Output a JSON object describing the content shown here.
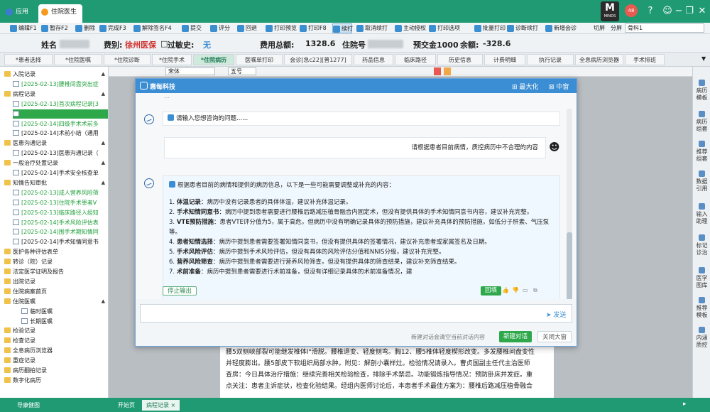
{
  "titlebar": {
    "tabs": [
      {
        "label": "应用"
      },
      {
        "label": "住院医生站"
      }
    ],
    "logo_text": "MINDS",
    "notification_badge": "48",
    "close_icon": "×"
  },
  "toolbar": {
    "buttons": [
      "编辑F1",
      "暂存F2",
      "删除",
      "完成F3",
      "解除签名F4",
      "提交",
      "评分",
      "回退",
      "打印预览",
      "打印F8",
      "续打",
      "取消续打",
      "主动授权",
      "打印选项",
      "批量打印",
      "诊断续打",
      "新增会诊"
    ],
    "active": "续打",
    "split_labels": [
      "切屏",
      "分屏"
    ],
    "font_value": "骨科1"
  },
  "patient": {
    "name_label": "姓名",
    "fee_label": "费别:",
    "fee_value": "徐州医保",
    "allergy_label": "过敏史:",
    "allergy_value": "无",
    "total_label": "费用总额:",
    "total_value": "1328.6",
    "admission_label": "住院号",
    "prepay_label": "预交金1000",
    "balance_label": "余额:",
    "balance_value": "-328.6"
  },
  "tabs": [
    "*患者选择",
    "*住院医嘱",
    "*住院诊断",
    "*住院手术",
    "*住院病历",
    "医嘱单打印",
    "会诊[急c22][普1277]",
    "药品信息",
    "临床路径",
    "历史信息",
    "计费明细",
    "执行记录",
    "全息病历浏览器",
    "手术排班"
  ],
  "active_tab": "*住院病历",
  "tree": [
    {
      "label": "入院记录",
      "type": "folder",
      "level": 0,
      "exp": "▲"
    },
    {
      "label": "[2025-02-13]腰椎间盘突出症",
      "type": "doc",
      "level": 1,
      "green": true
    },
    {
      "label": "病程记录",
      "type": "folder",
      "level": 0,
      "exp": "▲"
    },
    {
      "label": "[2025-02-13]首次病程记录[3",
      "type": "doc",
      "level": 1,
      "green": true
    },
    {
      "label": "",
      "type": "doc",
      "level": 1,
      "sel": true
    },
    {
      "label": "[2025-02-14]四级手术术前多",
      "type": "doc",
      "level": 1,
      "green": true
    },
    {
      "label": "[2025-02-14]术前小结（通用",
      "type": "doc",
      "level": 1
    },
    {
      "label": "医患沟通记录",
      "type": "folder",
      "level": 0,
      "exp": "▲"
    },
    {
      "label": "[2025-02-13]医患沟通记录（",
      "type": "doc",
      "level": 1
    },
    {
      "label": "一般治疗处置记录",
      "type": "folder",
      "level": 0,
      "exp": "▲"
    },
    {
      "label": "[2025-02-14]手术安全核查单",
      "type": "doc",
      "level": 1
    },
    {
      "label": "知情告知审批",
      "type": "folder",
      "level": 0,
      "exp": "▲"
    },
    {
      "label": "[2025-02-13]成人营养风险筛",
      "type": "doc",
      "level": 1,
      "green": true
    },
    {
      "label": "[2025-02-13]住院手术患者V",
      "type": "doc",
      "level": 1,
      "green": true
    },
    {
      "label": "[2025-02-13]临床路径入组知",
      "type": "doc",
      "level": 1,
      "green": true
    },
    {
      "label": "[2025-02-14]手术风险评估表",
      "type": "doc",
      "level": 1,
      "green": true
    },
    {
      "label": "[2025-02-14]围手术期知情同",
      "type": "doc",
      "level": 1,
      "green": true
    },
    {
      "label": "[2025-02-14]手术知情同意书",
      "type": "doc",
      "level": 1
    },
    {
      "label": "医护各种评估表单",
      "type": "folder",
      "level": 0
    },
    {
      "label": "转诊（院）记录",
      "type": "folder",
      "level": 0
    },
    {
      "label": "法定医学证明及报告",
      "type": "folder",
      "level": 0
    },
    {
      "label": "出院记录",
      "type": "folder",
      "level": 0
    },
    {
      "label": "住院病案首页",
      "type": "folder",
      "level": 0
    },
    {
      "label": "住院医嘱",
      "type": "folder",
      "level": 0,
      "exp": "▲"
    },
    {
      "label": "临时医嘱",
      "type": "doc",
      "level": 2
    },
    {
      "label": "长期医嘱",
      "type": "doc",
      "level": 2
    },
    {
      "label": "检验记录",
      "type": "folder",
      "level": 0
    },
    {
      "label": "检查记录",
      "type": "folder",
      "level": 0
    },
    {
      "label": "全息病历浏览器",
      "type": "folder",
      "level": 0
    },
    {
      "label": "重症记录",
      "type": "folder",
      "level": 0
    },
    {
      "label": "病历翻拍记录",
      "type": "folder",
      "level": 0
    },
    {
      "label": "数字化病历",
      "type": "folder",
      "level": 0
    }
  ],
  "editor": {
    "font": "宋体",
    "size": "五号",
    "page_lines": [
      "腰5双侧峡部裂可能继发椎体I°滑脱。腰椎退变、轻度侧弯。胸12、腰5椎体轻度楔形改变。多发腰椎间盘变性",
      "并轻度膨出。腰5部皮下软组织局部水肿。附见：解剖小囊样灶。检验情况请录入。曹贞国副主任代主治医师",
      "查房：今日具体治疗措施：继续完善相关检验检查，排除手术禁忌。功能锻炼指导情况：预防卧床并发症。重",
      "点关注：患者主诉症状，检查化验结果。经组内医师讨论后，本患者手术最佳方案为：腰椎后路减压植骨融合"
    ]
  },
  "right_tools": [
    "病历模板",
    "病历组套",
    "推荐组套",
    "数据引用",
    "输入助理",
    "标记诊治",
    "医学图库",
    "推荐模板",
    "内涵质控"
  ],
  "bottom_tabs": [
    {
      "label": "导康健图"
    },
    {
      "label": "开始页"
    },
    {
      "label": "病程记录"
    }
  ],
  "dialog": {
    "brand": "惠每科技",
    "maximize_label": "最大化",
    "center_label": "中窗",
    "top_fragment": "…",
    "prompt_hint": "请输入您想咨询的问题......",
    "user_message": "请根据患者目前病情，质控病历中不合理的内容",
    "answer_intro": "根据患者目前的病情和提供的病历信息，以下是一些可能需要调整或补充的内容：",
    "answer_items": [
      {
        "num": "1.",
        "title": "体温记录",
        "text": "：病历中没有记录患者的具体体温，建议补充体温记录。"
      },
      {
        "num": "2.",
        "title": "手术知情同意书",
        "text": "：病历中提到患者需要进行腰椎后路减压植骨融合内固定术，但没有提供具体的手术知情同意书内容，建议补充完整。"
      },
      {
        "num": "3.",
        "title": "VTE预防措施",
        "text": "：患者VTE评分值为5，属于高危，但病历中没有明确记录具体的预防措施，建议补充具体的预防措施，如低分子肝素、气压泵等。"
      },
      {
        "num": "4.",
        "title": "患者知情选择",
        "text": "：病历中提到患者需要签署知情同意书，但没有提供具体的签署情况，建议补充患者或家属签名及日期。"
      },
      {
        "num": "5.",
        "title": "手术风险评估",
        "text": "：病历中提到手术风险评估，但没有具体的风险评估分值和NNIS分级，建议补充完整。"
      },
      {
        "num": "6.",
        "title": "营养风险筛查",
        "text": "：病历中提到患者需要进行营养风险筛查，但没有提供具体的筛查结果，建议补充筛查结果。"
      },
      {
        "num": "7.",
        "title": "术前准备",
        "text": "：病历中提到患者需要进行术前准备，但没有详细记录具体的术前准备情况，建"
      }
    ],
    "stop_label": "停止输出",
    "back_label": "回填",
    "send_label": "发送",
    "new_chat_hint": "新建对话会清空当前对话内容",
    "new_chat_label": "新建对话",
    "close_label": "关闭大窗"
  }
}
